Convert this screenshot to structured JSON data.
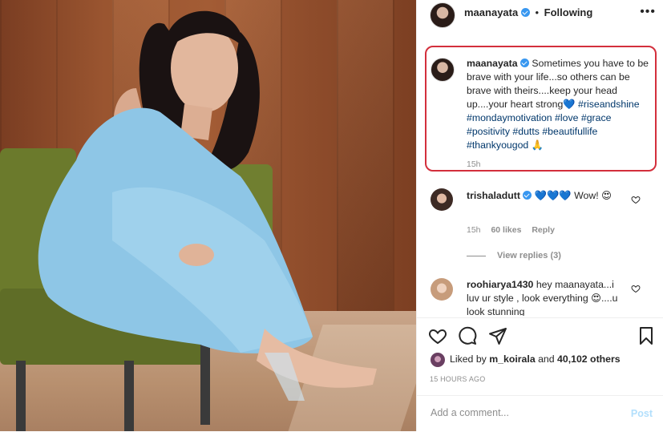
{
  "post": {
    "username": "maanayata",
    "follow_status": "Following",
    "more_icon": "more-horizontal-icon",
    "caption": {
      "text": "Sometimes you have to be brave with your life...so others can be brave with theirs....keep your head up....your heart strong",
      "heart_emoji": "💙",
      "hashtags": "#riseandshine #mondaymotivation #love #grace #positivity #dutts #beautifullife #thankyougod",
      "end_emoji": "🙏",
      "time": "15h"
    },
    "comments": [
      {
        "username": "trishaladutt",
        "text": "💙💙💙 Wow! 😍",
        "time": "15h",
        "likes": "60 likes",
        "reply": "Reply",
        "view_replies": "View replies (3)"
      },
      {
        "username": "roohiarya1430",
        "text": "hey maanayata...i luv ur style , look everything 😍....u look stunning"
      }
    ],
    "likes_text": {
      "prefix": "Liked by",
      "user": "m_koirala",
      "middle": "and",
      "count": "40,102 others"
    },
    "posted_ago": "15 HOURS AGO",
    "add_comment_placeholder": "Add a comment...",
    "post_label": "Post"
  },
  "colors": {
    "highlight_border": "#d32f3c",
    "hashtag": "#00376b",
    "verified": "#3897f0",
    "secondary_text": "#8e8e8e"
  }
}
